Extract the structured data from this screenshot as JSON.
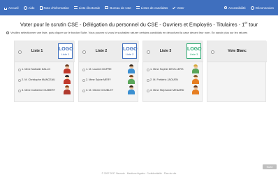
{
  "nav": {
    "home": "Accueil",
    "help": "Aide",
    "info": "Note d'information",
    "lists": "Liste électorale",
    "bureau": "Bureau de vote",
    "candidates": "Listes de candidats",
    "vote": "Voter",
    "accessibility": "Accessibilité",
    "logout": "Déconnexion"
  },
  "title": "Voter pour le scrutin CSE - Délégation du personnel du CSE - Ouvriers et Employés - Titulaires - 1",
  "title_sup": "er",
  "title_end": " tour",
  "instructions": "Veuillez sélectionner une liste, puis cliquer sur le bouton Suite. Vous pouvez si vous le souhaitez raturer certains candidats en décochant la case devant leur nom. En savoir plus sur les ratures",
  "lists": [
    {
      "name": "Liste 1",
      "logo_title": "LOGO",
      "logo_sub": "Liste 1",
      "logo_color": "#3f6fbe",
      "candidates": [
        {
          "name": "1. Mme Nathalie DALLO",
          "hair": "#6b3b1f",
          "shirt": "#c0392b"
        },
        {
          "name": "2. M. Christophe MANCEAU",
          "hair": "#2b2b2b",
          "shirt": "#c0392b"
        },
        {
          "name": "3. Mme Catherine GUIBERT",
          "hair": "#8a3b12",
          "shirt": "#b03a2e"
        }
      ]
    },
    {
      "name": "Liste 2",
      "logo_title": "LOGO",
      "logo_sub": "Liste 2",
      "logo_color": "#3f6fbe",
      "candidates": [
        {
          "name": "1. M. Laurent DUPRE",
          "hair": "#3a2a1a",
          "shirt": "#3b8fd0"
        },
        {
          "name": "2. Mme Sylvie MERY",
          "hair": "#7a4a22",
          "shirt": "#5aa65a"
        },
        {
          "name": "3. M. Olivier DOUBLET",
          "hair": "#3a2a1a",
          "shirt": "#3b8fd0"
        }
      ]
    },
    {
      "name": "Liste 3",
      "logo_title": "LOGO",
      "logo_sub": "Liste 3",
      "logo_color": "#2eaa73",
      "candidates": [
        {
          "name": "1. Mme Sophie DEVILLERS",
          "hair": "#d4a83a",
          "shirt": "#5aa65a"
        },
        {
          "name": "2. M. Frédéric JAOUEN",
          "hair": "#8a5a2a",
          "shirt": "#e67e22"
        },
        {
          "name": "3. Mme Stéphanie MENARD",
          "hair": "#6b3b1f",
          "shirt": "#e67e22"
        }
      ]
    },
    {
      "name": "Vote Blanc",
      "candidates": []
    }
  ],
  "footer": "© 2007-2017 Neovote · Mentions légales · Confidentialité · Plan du site",
  "next_button": "Suite"
}
